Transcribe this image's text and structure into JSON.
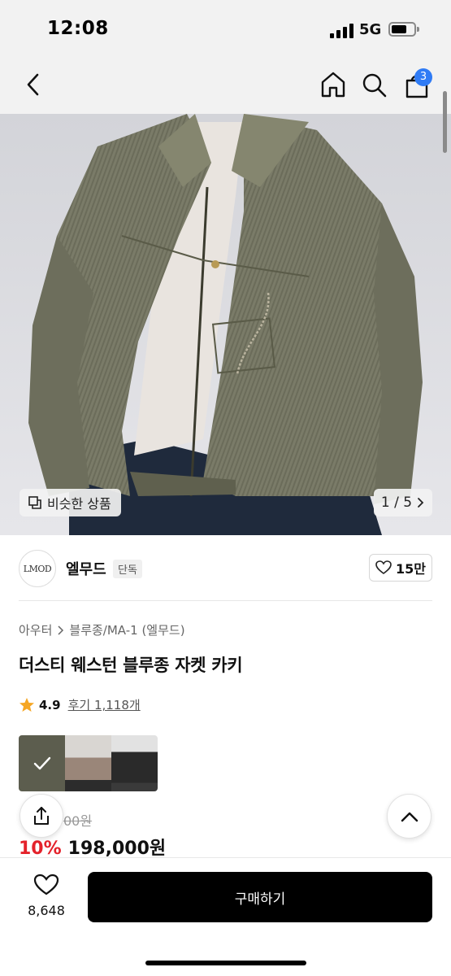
{
  "status_bar": {
    "time": "12:08",
    "network": "5G"
  },
  "nav": {
    "back_icon": "chevron-left-icon",
    "home_icon": "home-icon",
    "search_icon": "search-icon",
    "cart_icon": "shopping-bag-icon",
    "cart_count": "3"
  },
  "hero": {
    "similar_label": "비슷한 상품",
    "page_indicator": "1 / 5"
  },
  "brand": {
    "logo_text": "LMOD",
    "name": "엘무드",
    "tag": "단독",
    "likes": "15만"
  },
  "product": {
    "breadcrumb": [
      "아우터",
      "블루종/MA-1 (엘무드)"
    ],
    "title": "더스티 웨스턴 블루종 자켓 카키",
    "rating": "4.9",
    "reviews": "후기 1,118개",
    "original_price_visible": "00원",
    "discount": "10%",
    "sale_price": "198,000원"
  },
  "bottom_bar": {
    "wish_count": "8,648",
    "buy_label": "구매하기"
  },
  "colors": {
    "accent_blue": "#2f7bf5",
    "discount_red": "#e4222b",
    "star": "#f5a623",
    "jacket": "#7a7b68"
  }
}
